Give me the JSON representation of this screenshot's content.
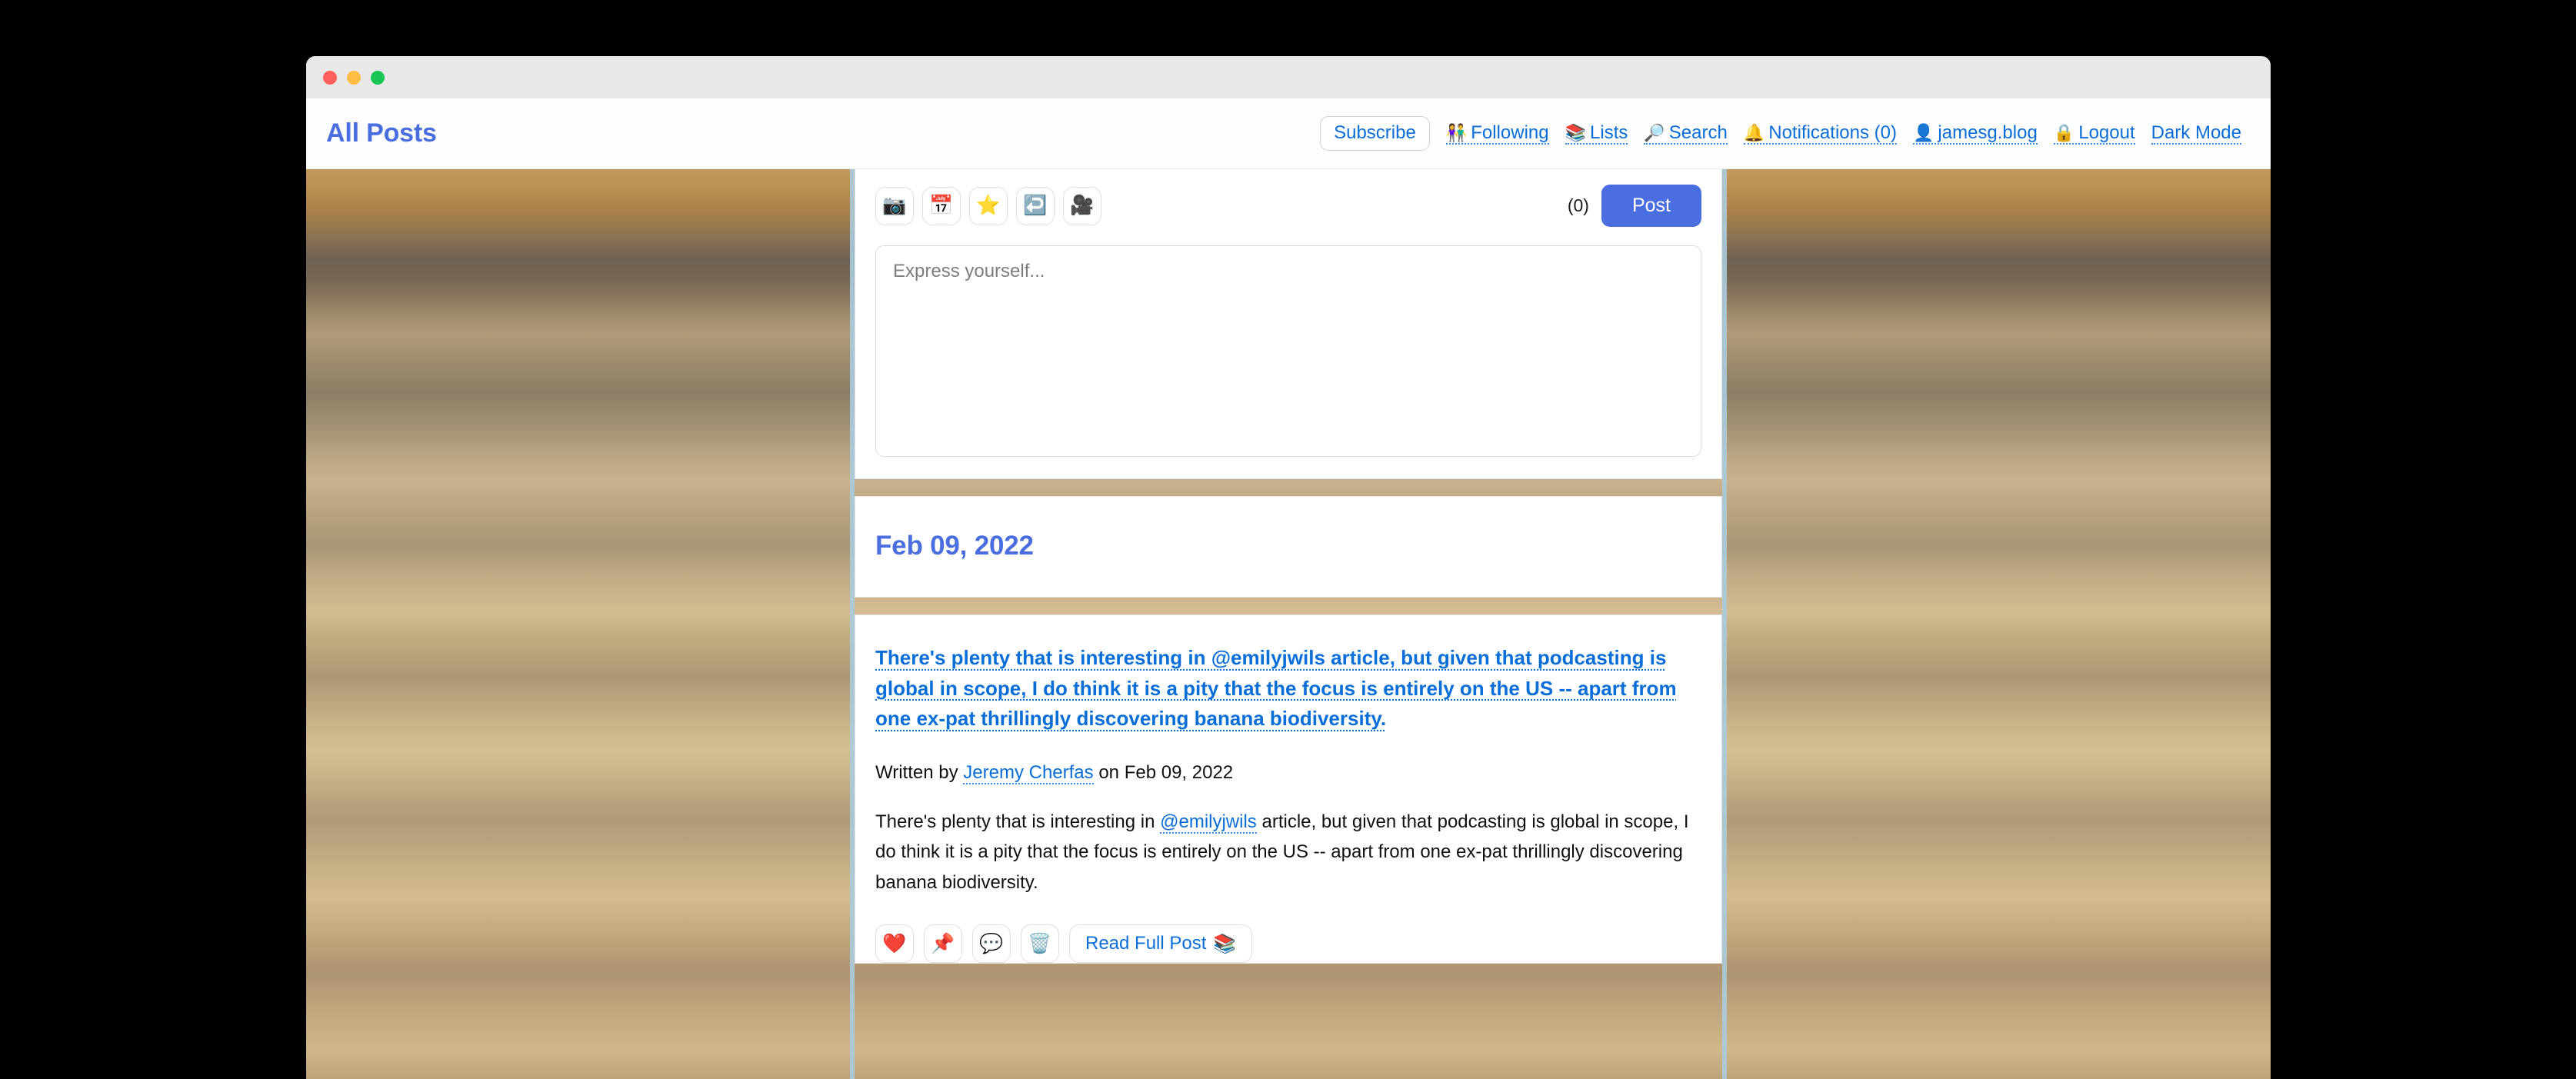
{
  "window": {
    "traffic_lights": [
      {
        "name": "close",
        "color": "#ff605c"
      },
      {
        "name": "minimize",
        "color": "#ffbd44"
      },
      {
        "name": "maximize",
        "color": "#17c653"
      }
    ]
  },
  "header": {
    "title": "All Posts",
    "title_color": "#4a6ee0",
    "subscribe_label": "Subscribe",
    "nav": [
      {
        "icon": "👫",
        "icon_name": "two-people-icon",
        "label": "Following"
      },
      {
        "icon": "📚",
        "icon_name": "books-icon",
        "label": "Lists"
      },
      {
        "icon": "🔎",
        "icon_name": "magnifying-glass-icon",
        "label": "Search"
      },
      {
        "icon": "🔔",
        "icon_name": "bell-icon",
        "label": "Notifications (0)"
      },
      {
        "icon": "👤",
        "icon_name": "person-icon",
        "label": "jamesg.blog"
      },
      {
        "icon": "🔒",
        "icon_name": "lock-icon",
        "label": "Logout"
      },
      {
        "icon": "",
        "icon_name": "none",
        "label": "Dark Mode"
      }
    ],
    "link_color": "#0a6ed8"
  },
  "compose": {
    "tools": [
      {
        "icon": "📷",
        "icon_name": "camera-icon"
      },
      {
        "icon": "📅",
        "icon_name": "calendar-icon"
      },
      {
        "icon": "⭐",
        "icon_name": "star-icon"
      },
      {
        "icon": "↩️",
        "icon_name": "reply-arrow-icon"
      },
      {
        "icon": "🎥",
        "icon_name": "movie-camera-icon"
      }
    ],
    "char_count": "(0)",
    "post_label": "Post",
    "post_button_color": "#4a6ee0",
    "textarea_value": "",
    "textarea_placeholder": "Express yourself..."
  },
  "date_group": {
    "heading": "Feb 09, 2022",
    "heading_color": "#4a6ee0"
  },
  "post": {
    "title": "There's plenty that is interesting in @emilyjwils article, but given that podcasting is global in scope, I do think it is a pity that the focus is entirely on the US -- apart from one ex-pat thrillingly discovering banana biodiversity.",
    "byline_prefix": "Written by",
    "author": "Jeremy Cherfas",
    "byline_middle": "on",
    "byline_date": "Feb 09, 2022",
    "excerpt_part1": "There's plenty that is interesting in ",
    "excerpt_mention": "@emilyjwils",
    "excerpt_part2": " article, but given that podcasting is global in scope, I do think it is a pity that the focus is entirely on the US -- apart from one ex-pat thrillingly discovering banana biodiversity.",
    "actions": [
      {
        "icon": "❤️",
        "icon_name": "heart-icon"
      },
      {
        "icon": "📌",
        "icon_name": "pushpin-icon"
      },
      {
        "icon": "💬",
        "icon_name": "speech-balloon-icon"
      },
      {
        "icon": "🗑️",
        "icon_name": "wastebasket-icon"
      }
    ],
    "read_full_label": "Read Full Post",
    "read_full_icon": "📚",
    "read_full_icon_name": "books-icon"
  }
}
